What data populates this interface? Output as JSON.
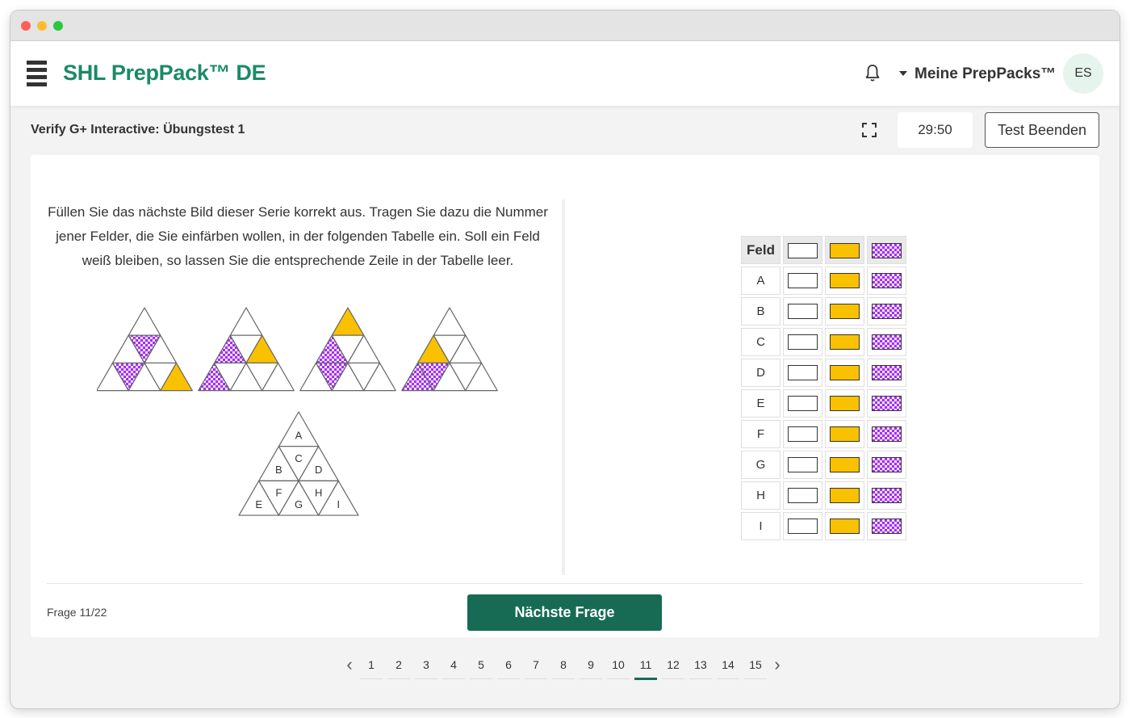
{
  "app": {
    "brand": "SHL PrepPack™ DE",
    "menu_label": "Meine PrepPacks™",
    "avatar_initials": "ES"
  },
  "test": {
    "title": "Verify G+ Interactive: Übungstest 1",
    "timer": "29:50",
    "end_label": "Test Beenden"
  },
  "question": {
    "text": "Füllen Sie das nächste Bild dieser Serie korrekt aus. Tragen Sie dazu die Nummer jener Felder, die Sie einfärben wollen, in der folgenden Tabelle ein. Soll ein Feld weiß bleiben, so lassen Sie die entsprechende Zeile in der Tabelle leer.",
    "key_labels": [
      "A",
      "B",
      "C",
      "D",
      "E",
      "F",
      "G",
      "H",
      "I"
    ]
  },
  "grid": {
    "header": "Feld",
    "rows": [
      "A",
      "B",
      "C",
      "D",
      "E",
      "F",
      "G",
      "H",
      "I"
    ],
    "options": [
      "white",
      "yellow",
      "checkered-purple"
    ]
  },
  "footer": {
    "progress": "Frage 11/22",
    "next_label": "Nächste Frage"
  },
  "pagination": {
    "pages": [
      "1",
      "2",
      "3",
      "4",
      "5",
      "6",
      "7",
      "8",
      "9",
      "10",
      "11",
      "12",
      "13",
      "14",
      "15"
    ],
    "current": "11"
  },
  "colors": {
    "brand": "#1b8a68",
    "primary_button": "#176b55",
    "yellow": "#f9c100",
    "purple": "#a42ff0"
  }
}
